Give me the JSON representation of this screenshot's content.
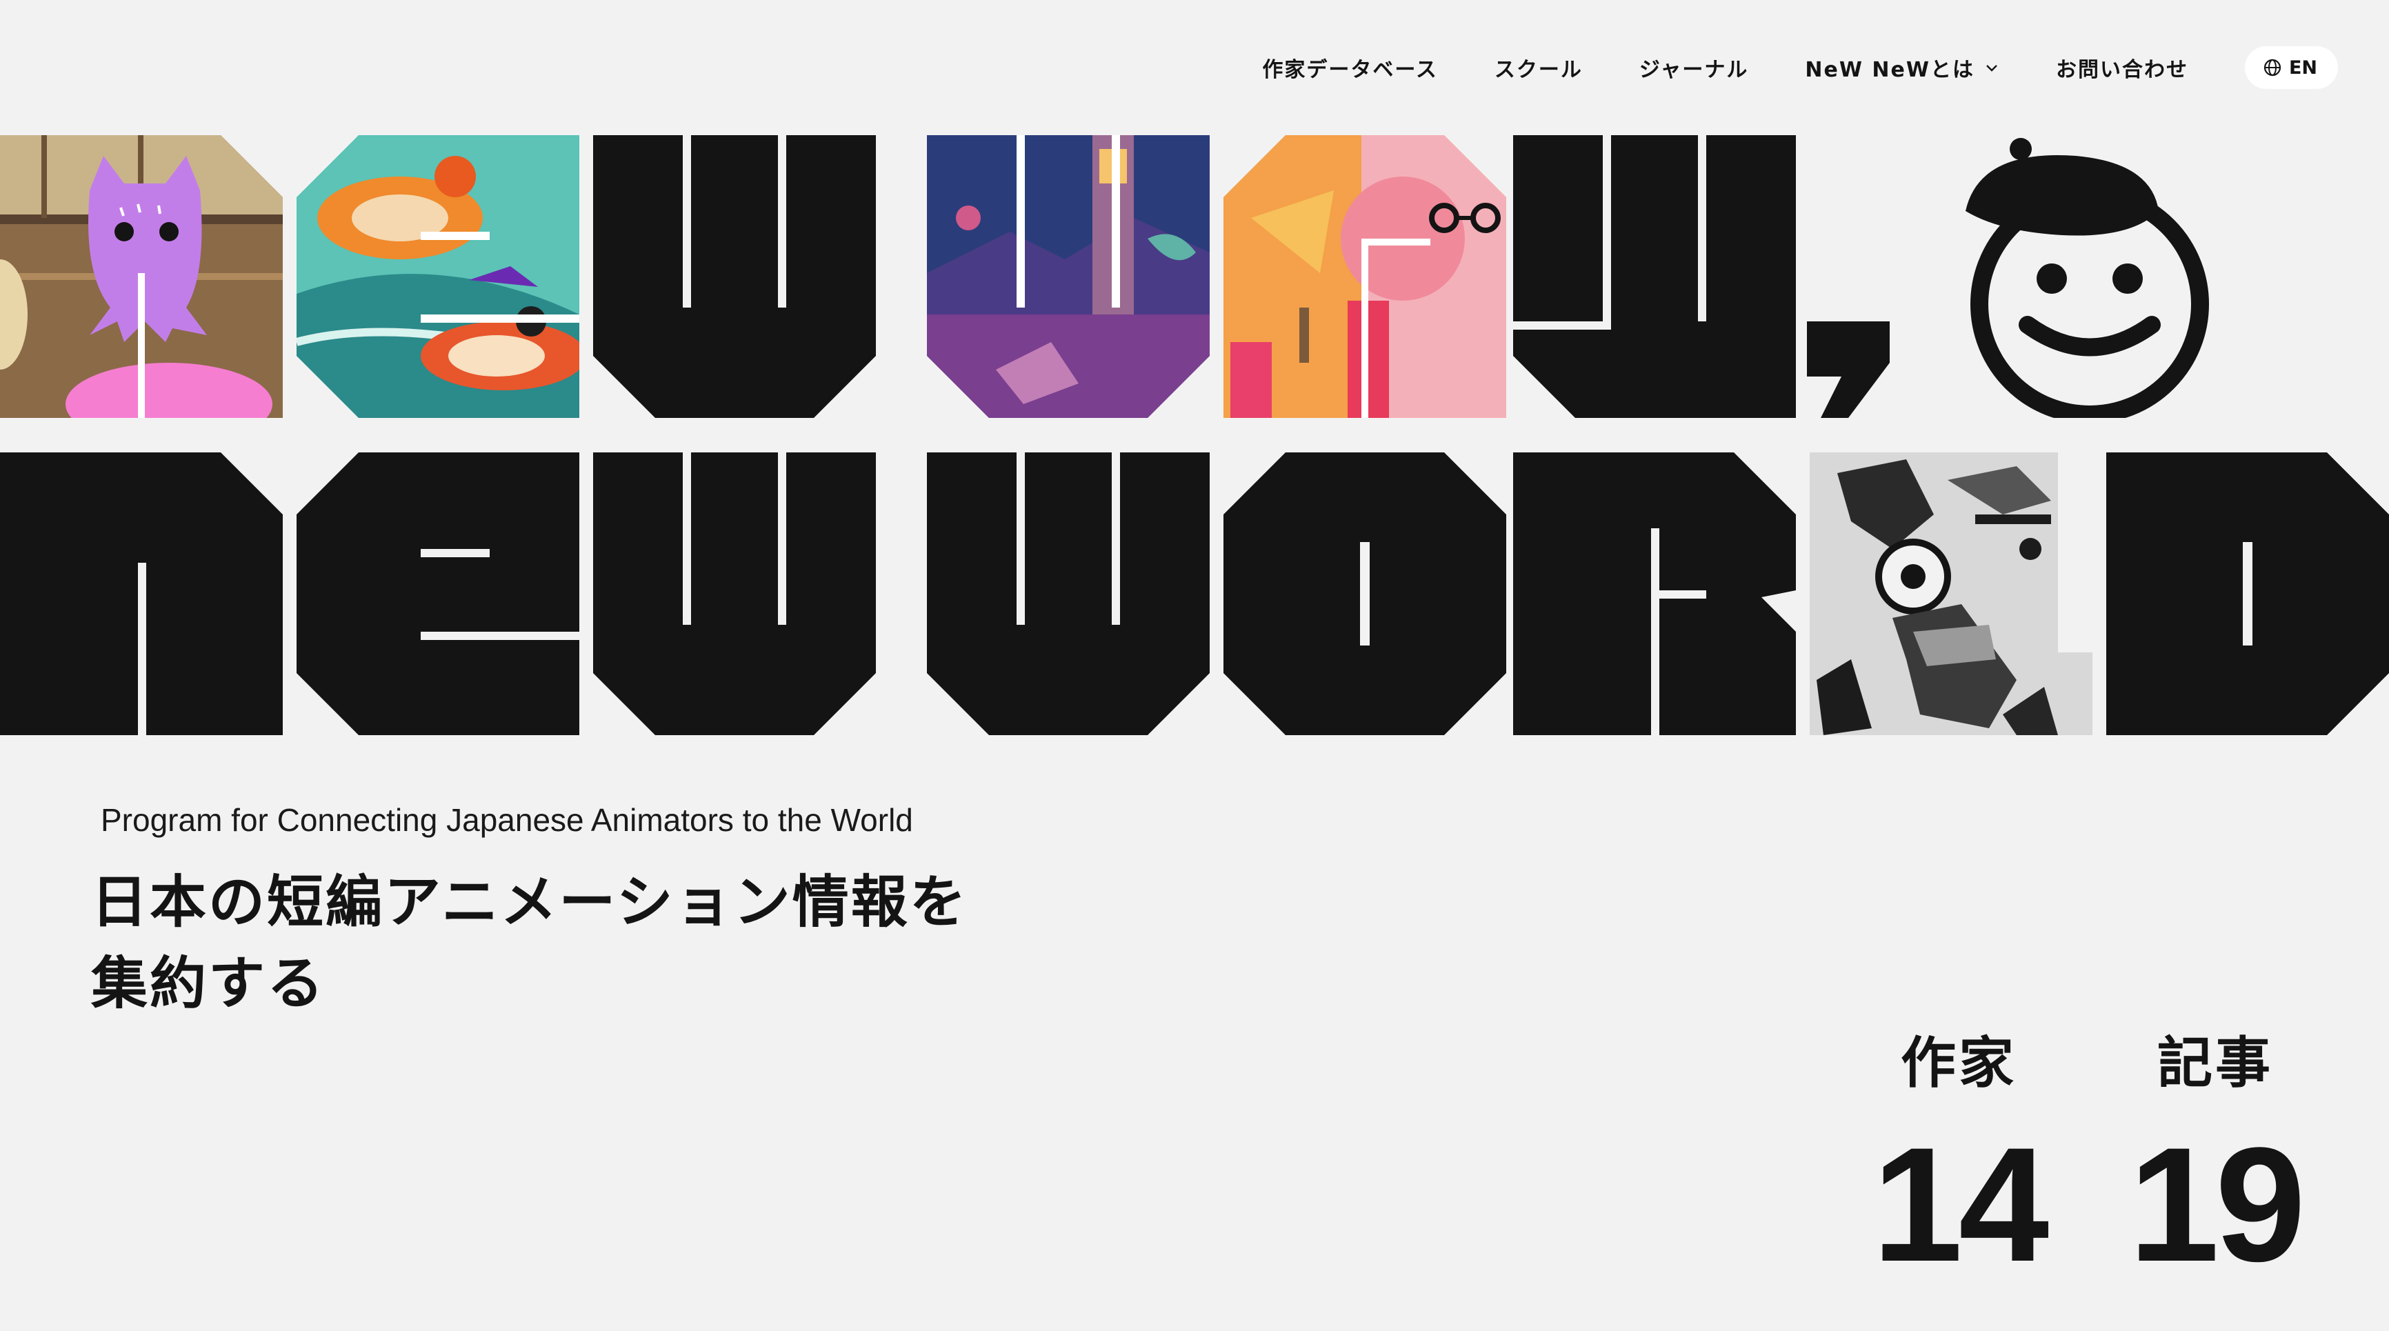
{
  "nav": {
    "items": [
      {
        "label": "作家データベース",
        "name": "nav-item-artist-database"
      },
      {
        "label": "スクール",
        "name": "nav-item-school"
      },
      {
        "label": "ジャーナル",
        "name": "nav-item-journal"
      },
      {
        "label": "NeW NeWとは",
        "name": "nav-item-about",
        "dropdown": true
      },
      {
        "label": "お問い合わせ",
        "name": "nav-item-contact"
      }
    ],
    "language": {
      "label": "EN",
      "icon": "globe-icon"
    }
  },
  "hero": {
    "headline_art": "NeW WaY, NeW WORLD",
    "mascot_icon": "beret-smiley-icon"
  },
  "subtitle": "Program for Connecting Japanese Animators to the World",
  "headline": {
    "line1": "日本の短編アニメーション情報を",
    "line2": "集約する"
  },
  "stats": {
    "artists": {
      "label": "作家",
      "value": "14"
    },
    "articles": {
      "label": "記事",
      "value": "19"
    }
  },
  "colors": {
    "background": "#f2f2f2",
    "ink": "#141414",
    "lang_button_bg": "#ffffff"
  }
}
